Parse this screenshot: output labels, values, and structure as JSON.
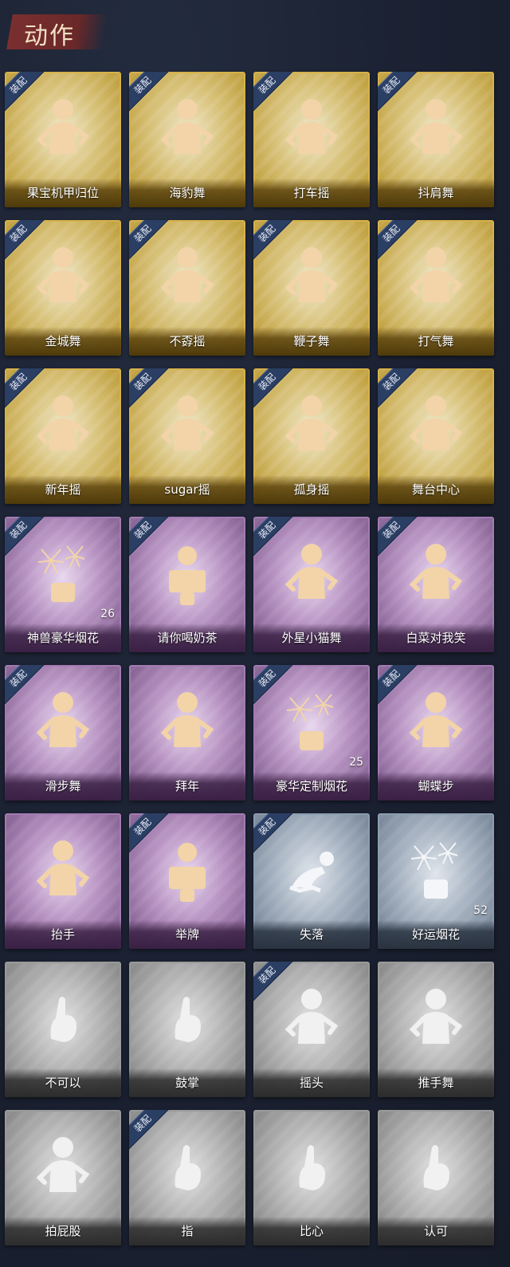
{
  "header": {
    "title": "动作"
  },
  "equipped_label": "装配",
  "cards": [
    {
      "label": "果宝机甲归位",
      "rarity": "gold",
      "equipped": true,
      "icon": "dance-pose-icon"
    },
    {
      "label": "海豹舞",
      "rarity": "gold",
      "equipped": true,
      "icon": "dance-pose-icon"
    },
    {
      "label": "打车摇",
      "rarity": "gold",
      "equipped": true,
      "icon": "dance-pose-icon"
    },
    {
      "label": "抖肩舞",
      "rarity": "gold",
      "equipped": true,
      "icon": "dance-pose-icon"
    },
    {
      "label": "金城舞",
      "rarity": "gold",
      "equipped": true,
      "icon": "dance-pose-icon"
    },
    {
      "label": "不孬摇",
      "rarity": "gold",
      "equipped": true,
      "icon": "dance-pose-icon"
    },
    {
      "label": "鞭子舞",
      "rarity": "gold",
      "equipped": true,
      "icon": "dance-pose-icon"
    },
    {
      "label": "打气舞",
      "rarity": "gold",
      "equipped": true,
      "icon": "dance-pose-icon"
    },
    {
      "label": "新年摇",
      "rarity": "gold",
      "equipped": true,
      "icon": "dance-pose-icon"
    },
    {
      "label": "sugar摇",
      "rarity": "gold",
      "equipped": true,
      "icon": "dance-pose-icon"
    },
    {
      "label": "孤身摇",
      "rarity": "gold",
      "equipped": true,
      "icon": "dance-pose-icon"
    },
    {
      "label": "舞台中心",
      "rarity": "gold",
      "equipped": true,
      "icon": "dance-pose-icon"
    },
    {
      "label": "神兽豪华烟花",
      "rarity": "purple",
      "equipped": true,
      "icon": "firework-icon",
      "count": "26"
    },
    {
      "label": "请你喝奶茶",
      "rarity": "purple",
      "equipped": true,
      "icon": "milk-tea-sign-icon"
    },
    {
      "label": "外星小猫舞",
      "rarity": "purple",
      "equipped": true,
      "icon": "dance-pose-icon"
    },
    {
      "label": "白菜对我笑",
      "rarity": "purple",
      "equipped": true,
      "icon": "dance-pose-icon"
    },
    {
      "label": "滑步舞",
      "rarity": "purple",
      "equipped": true,
      "icon": "dance-pose-icon"
    },
    {
      "label": "拜年",
      "rarity": "purple",
      "equipped": false,
      "icon": "bow-pose-icon"
    },
    {
      "label": "豪华定制烟花",
      "rarity": "purple",
      "equipped": true,
      "icon": "firework-icon",
      "count": "25"
    },
    {
      "label": "蝴蝶步",
      "rarity": "purple",
      "equipped": true,
      "icon": "point-pose-icon"
    },
    {
      "label": "抬手",
      "rarity": "purple",
      "equipped": false,
      "icon": "raise-hand-icon"
    },
    {
      "label": "举牌",
      "rarity": "purple",
      "equipped": true,
      "icon": "hold-sign-icon"
    },
    {
      "label": "失落",
      "rarity": "blue",
      "equipped": true,
      "icon": "crawl-pose-icon"
    },
    {
      "label": "好运烟花",
      "rarity": "blue",
      "equipped": false,
      "icon": "firework-icon",
      "count": "52"
    },
    {
      "label": "不可以",
      "rarity": "gray",
      "equipped": false,
      "icon": "finger-wag-icon"
    },
    {
      "label": "鼓掌",
      "rarity": "gray",
      "equipped": false,
      "icon": "clap-icon"
    },
    {
      "label": "摇头",
      "rarity": "gray",
      "equipped": true,
      "icon": "shake-head-icon"
    },
    {
      "label": "推手舞",
      "rarity": "gray",
      "equipped": false,
      "icon": "push-hand-icon"
    },
    {
      "label": "拍屁股",
      "rarity": "gray",
      "equipped": false,
      "icon": "slap-pose-icon"
    },
    {
      "label": "指",
      "rarity": "gray",
      "equipped": true,
      "icon": "point-hand-icon"
    },
    {
      "label": "比心",
      "rarity": "gray",
      "equipped": false,
      "icon": "heart-hand-icon"
    },
    {
      "label": "认可",
      "rarity": "gray",
      "equipped": false,
      "icon": "thumbs-up-icon"
    }
  ]
}
